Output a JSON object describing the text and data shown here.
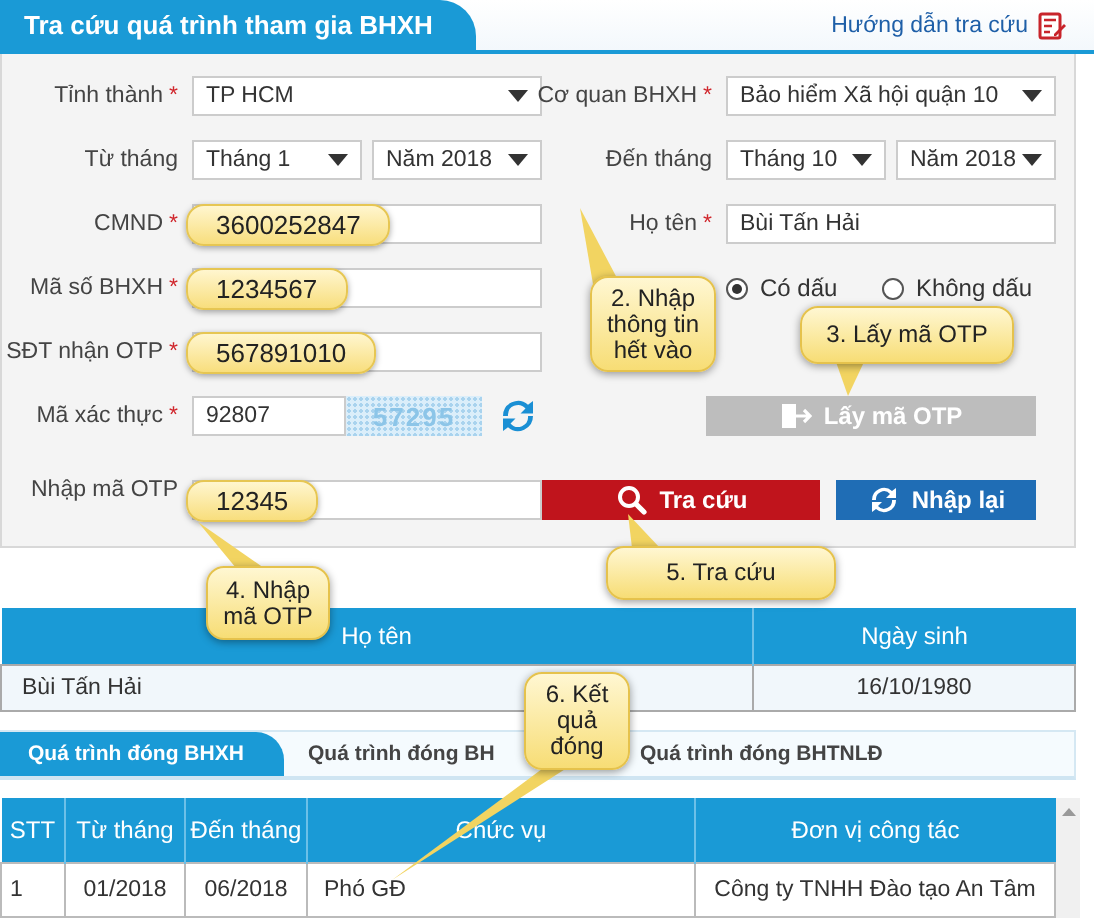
{
  "header": {
    "title": "Tra cứu quá trình tham gia BHXH",
    "help_link": "Hướng dẫn tra cứu"
  },
  "form": {
    "rows": [
      {
        "left": {
          "kind": "select",
          "label": "Tỉnh thành",
          "mark": "*",
          "value": "TP HCM"
        },
        "right": {
          "kind": "select",
          "label": "Cơ quan BHXH",
          "mark": "*",
          "value": "Bảo hiểm Xã hội quận 10"
        }
      },
      {
        "left": {
          "kind": "select_pair",
          "label": "Từ tháng",
          "values": [
            "Tháng 1",
            "Năm 2018"
          ]
        },
        "right": {
          "kind": "select_pair",
          "label": "Đến tháng",
          "values": [
            "Tháng 10",
            "Năm 2018"
          ]
        }
      },
      {
        "left": {
          "kind": "input",
          "label": "CMND",
          "mark": "*",
          "value": "3600252847",
          "highlighted": true
        },
        "right": {
          "kind": "input",
          "label": "Họ tên",
          "mark": "*",
          "value": "Bùi Tấn Hải",
          "highlighted": false
        }
      },
      {
        "left": {
          "kind": "input",
          "label": "Mã số BHXH",
          "mark": "*",
          "value": "1234567",
          "highlighted": true
        },
        "right": {
          "kind": "radios",
          "options": [
            {
              "label": "Có dấu",
              "selected": true
            },
            {
              "label": "Không dấu",
              "selected": false
            }
          ]
        }
      },
      {
        "left": {
          "kind": "input",
          "label": "SĐT nhận OTP",
          "mark": "*",
          "value": "567891010",
          "highlighted": true
        }
      },
      {
        "left": {
          "kind": "captcha",
          "label": "Mã xác thực",
          "mark": "*",
          "value": "92807",
          "code": "57295"
        },
        "right": {
          "kind": "buttons",
          "buttons": [
            {
              "kind": "otp",
              "label": "Lấy mã OTP",
              "disabled": true
            }
          ]
        }
      },
      {
        "left": {
          "kind": "input",
          "label": "Nhập mã OTP",
          "value": "12345",
          "highlighted": true
        },
        "right": {
          "kind": "buttons",
          "buttons": [
            {
              "kind": "search",
              "label": "Tra cứu",
              "disabled": false
            },
            {
              "kind": "reset",
              "label": "Nhập lại",
              "disabled": false
            }
          ]
        }
      }
    ]
  },
  "person_table": {
    "columns": [
      "Họ tên",
      "Ngày sinh"
    ],
    "rows": [
      [
        "Bùi Tấn Hải",
        "16/10/1980"
      ]
    ]
  },
  "tabs": [
    {
      "label": "Quá trình đóng BHXH",
      "selected": true
    },
    {
      "label": "Quá trình đóng BH",
      "selected": false
    },
    {
      "label": "Quá trình đóng BHTNLĐ",
      "selected": false
    }
  ],
  "history_table": {
    "columns": [
      "STT",
      "Từ tháng",
      "Đến tháng",
      "Chức vụ",
      "Đơn vị công tác"
    ],
    "rows": [
      [
        "1",
        "01/2018",
        "06/2018",
        "Phó GĐ",
        "Công ty TNHH Đào tạo An Tâm"
      ]
    ]
  },
  "callouts": [
    {
      "text": "2. Nhập thông tin hết vào"
    },
    {
      "text": "3. Lấy mã OTP"
    },
    {
      "text": "4. Nhập mã OTP"
    },
    {
      "text": "5. Tra cứu"
    },
    {
      "text": "6. Kết quả đóng"
    }
  ]
}
